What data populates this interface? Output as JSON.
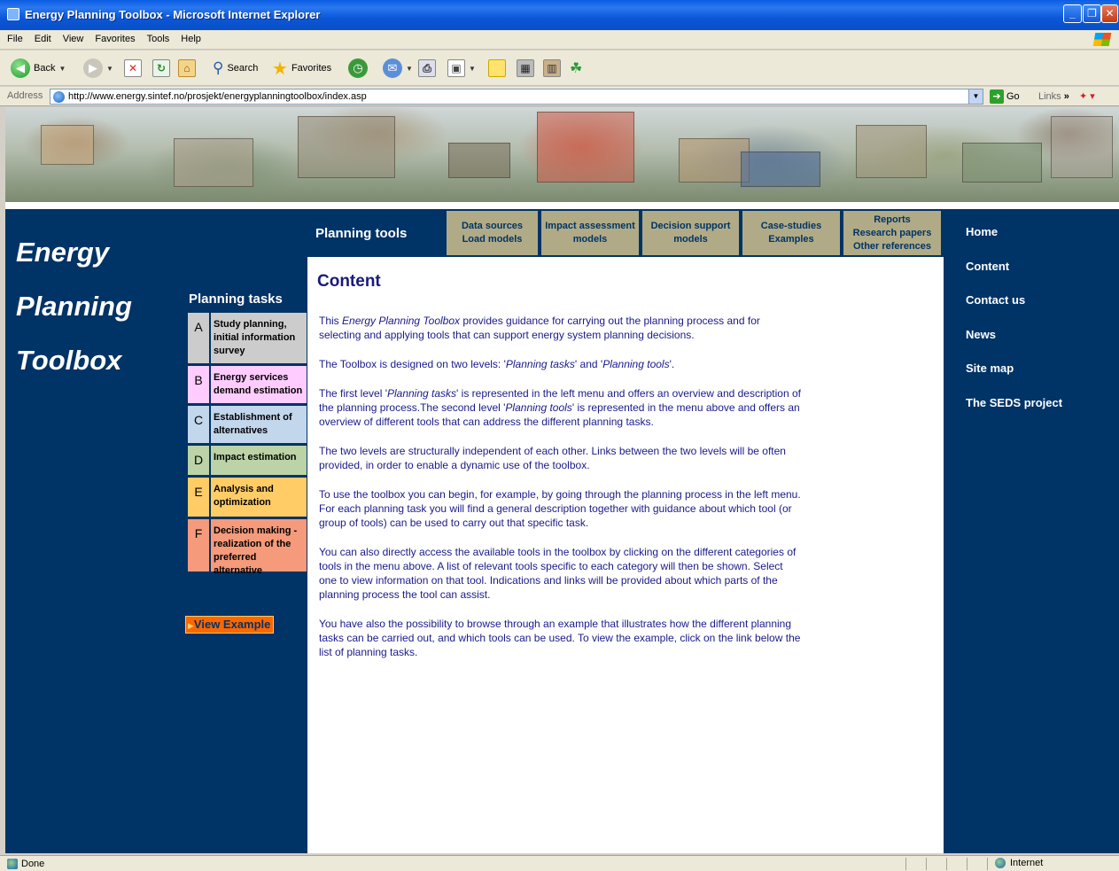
{
  "window": {
    "title": "Energy Planning Toolbox - Microsoft Internet Explorer",
    "min_glyph": "_",
    "max_glyph": "❐",
    "close_glyph": "✕"
  },
  "menu": [
    "File",
    "Edit",
    "View",
    "Favorites",
    "Tools",
    "Help"
  ],
  "toolbar": {
    "back_label": "Back",
    "search_label": "Search",
    "favorites_label": "Favorites"
  },
  "address": {
    "label": "Address",
    "url": "http://www.energy.sintef.no/prosjekt/energyplanningtoolbox/index.asp",
    "go_label": "Go",
    "links_label": "Links"
  },
  "site": {
    "title_lines": [
      "Energy",
      "Planning",
      "Toolbox"
    ],
    "planning_tools_label": "Planning tools",
    "tool_tabs": [
      {
        "line1": "Data sources",
        "line2": "Load models",
        "line3": ""
      },
      {
        "line1": "Impact assessment",
        "line2": "models",
        "line3": ""
      },
      {
        "line1": "Decision support",
        "line2": "models",
        "line3": ""
      },
      {
        "line1": "Case-studies",
        "line2": "Examples",
        "line3": ""
      },
      {
        "line1": "Reports",
        "line2": "Research papers",
        "line3": "Other references"
      }
    ],
    "tasks_heading": "Planning tasks",
    "tasks": [
      {
        "letter": "A",
        "label": "Study planning, initial information survey",
        "color": "#cccccc"
      },
      {
        "letter": "B",
        "label": "Energy services demand estimation",
        "color": "#ffccff"
      },
      {
        "letter": "C",
        "label": "Establishment of alternatives",
        "color": "#c2d6ec"
      },
      {
        "letter": "D",
        "label": "Impact estimation",
        "color": "#bbd3a6"
      },
      {
        "letter": "E",
        "label": "Analysis and optimization",
        "color": "#ffcc66"
      },
      {
        "letter": "F",
        "label": "Decision making - realization of the preferred alternative",
        "color": "#f59a7a"
      }
    ],
    "view_example_label": "View Example",
    "content_title": "Content",
    "right_nav": [
      "Home",
      "Content",
      "Contact us",
      "News",
      "Site map",
      "The SEDS project"
    ],
    "background_color": "#003366",
    "tab_color": "#b0ab86"
  },
  "content": {
    "p1_a": "This ",
    "p1_em": "Energy Planning Toolbox",
    "p1_b": " provides guidance for carrying out the planning process and for selecting and applying tools that can support energy system planning decisions.",
    "p2_a": "The Toolbox is designed on two levels: '",
    "p2_em1": "Planning tasks",
    "p2_b": "' and '",
    "p2_em2": "Planning tools",
    "p2_c": "'.",
    "p3_a": "The first level '",
    "p3_em1": "Planning tasks",
    "p3_b": "' is represented in the left menu and offers an overview and description of the planning process.The second level '",
    "p3_em2": "Planning tools",
    "p3_c": "' is represented in the menu above and offers an overview of different tools that can address the different planning tasks.",
    "p4": "The two levels are structurally independent of each other. Links between the two levels will be often provided, in order to enable a dynamic use of the toolbox.",
    "p5": "To use the toolbox you can begin, for example, by going through the planning process in the left menu. For each planning task you will find a general description together with guidance about which tool (or group of tools) can be used to carry out that specific task.",
    "p6": "You can also directly access the available tools in the toolbox by clicking on the different categories of tools in the menu above. A list of relevant tools specific to each category will then be shown. Select one to view information on that tool. Indications and links will be provided about which parts of the planning process the tool can assist.",
    "p7": "You have also the possibility to browse through an example that illustrates how the different planning tasks can be carried out, and which tools can be used. To view the example, click on the link below the list of planning tasks."
  },
  "status": {
    "text": "Done",
    "zone": "Internet"
  }
}
